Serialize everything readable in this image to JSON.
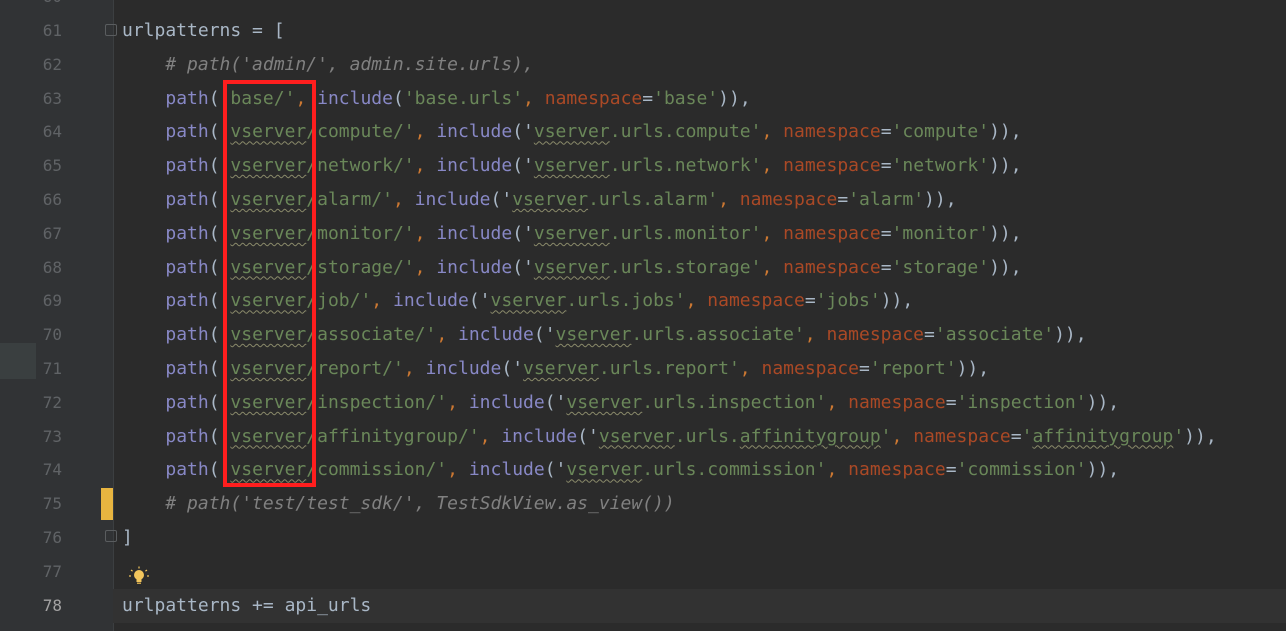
{
  "editor": {
    "lines": [
      {
        "num": "61",
        "tokens": [
          {
            "t": "urlpatterns ",
            "c": "kw"
          },
          {
            "t": "=",
            "c": "kw"
          },
          {
            "t": " [",
            "c": "kw"
          }
        ]
      },
      {
        "num": "62",
        "tokens": [
          {
            "t": "    # path('admin/', admin.site.urls),",
            "c": "cmg"
          }
        ]
      },
      {
        "num": "63",
        "tokens": [
          {
            "t": "    ",
            "c": "kw"
          },
          {
            "t": "path",
            "c": "fn"
          },
          {
            "t": "('",
            "c": "kw"
          },
          {
            "t": "base/'",
            "c": "str"
          },
          {
            "t": ", ",
            "c": "op"
          },
          {
            "t": "include",
            "c": "fn"
          },
          {
            "t": "(",
            "c": "kw"
          },
          {
            "t": "'base.urls'",
            "c": "str"
          },
          {
            "t": ", ",
            "c": "op"
          },
          {
            "t": "namespace",
            "c": "named"
          },
          {
            "t": "=",
            "c": "kw"
          },
          {
            "t": "'base'",
            "c": "str"
          },
          {
            "t": ")),",
            "c": "kw"
          }
        ]
      },
      {
        "num": "64",
        "tokens": [
          {
            "t": "    ",
            "c": "kw"
          },
          {
            "t": "path",
            "c": "fn"
          },
          {
            "t": "('",
            "c": "kw"
          },
          {
            "t": "vserver",
            "c": "str wavy"
          },
          {
            "t": "/compute/'",
            "c": "str"
          },
          {
            "t": ", ",
            "c": "op"
          },
          {
            "t": "include",
            "c": "fn"
          },
          {
            "t": "('",
            "c": "kw"
          },
          {
            "t": "vserver",
            "c": "str wavy"
          },
          {
            "t": ".urls.compute'",
            "c": "str"
          },
          {
            "t": ", ",
            "c": "op"
          },
          {
            "t": "namespace",
            "c": "named"
          },
          {
            "t": "=",
            "c": "kw"
          },
          {
            "t": "'compute'",
            "c": "str"
          },
          {
            "t": ")),",
            "c": "kw"
          }
        ]
      },
      {
        "num": "65",
        "tokens": [
          {
            "t": "    ",
            "c": "kw"
          },
          {
            "t": "path",
            "c": "fn"
          },
          {
            "t": "('",
            "c": "kw"
          },
          {
            "t": "vserver",
            "c": "str wavy"
          },
          {
            "t": "/network/'",
            "c": "str"
          },
          {
            "t": ", ",
            "c": "op"
          },
          {
            "t": "include",
            "c": "fn"
          },
          {
            "t": "('",
            "c": "kw"
          },
          {
            "t": "vserver",
            "c": "str wavy"
          },
          {
            "t": ".urls.network'",
            "c": "str"
          },
          {
            "t": ", ",
            "c": "op"
          },
          {
            "t": "namespace",
            "c": "named"
          },
          {
            "t": "=",
            "c": "kw"
          },
          {
            "t": "'network'",
            "c": "str"
          },
          {
            "t": ")),",
            "c": "kw"
          }
        ]
      },
      {
        "num": "66",
        "tokens": [
          {
            "t": "    ",
            "c": "kw"
          },
          {
            "t": "path",
            "c": "fn"
          },
          {
            "t": "('",
            "c": "kw"
          },
          {
            "t": "vserver",
            "c": "str wavy"
          },
          {
            "t": "/alarm/'",
            "c": "str"
          },
          {
            "t": ", ",
            "c": "op"
          },
          {
            "t": "include",
            "c": "fn"
          },
          {
            "t": "('",
            "c": "kw"
          },
          {
            "t": "vserver",
            "c": "str wavy"
          },
          {
            "t": ".urls.alarm'",
            "c": "str"
          },
          {
            "t": ", ",
            "c": "op"
          },
          {
            "t": "namespace",
            "c": "named"
          },
          {
            "t": "=",
            "c": "kw"
          },
          {
            "t": "'alarm'",
            "c": "str"
          },
          {
            "t": ")),",
            "c": "kw"
          }
        ]
      },
      {
        "num": "67",
        "tokens": [
          {
            "t": "    ",
            "c": "kw"
          },
          {
            "t": "path",
            "c": "fn"
          },
          {
            "t": "('",
            "c": "kw"
          },
          {
            "t": "vserver",
            "c": "str wavy"
          },
          {
            "t": "/monitor/'",
            "c": "str"
          },
          {
            "t": ", ",
            "c": "op"
          },
          {
            "t": "include",
            "c": "fn"
          },
          {
            "t": "('",
            "c": "kw"
          },
          {
            "t": "vserver",
            "c": "str wavy"
          },
          {
            "t": ".urls.monitor'",
            "c": "str"
          },
          {
            "t": ", ",
            "c": "op"
          },
          {
            "t": "namespace",
            "c": "named"
          },
          {
            "t": "=",
            "c": "kw"
          },
          {
            "t": "'monitor'",
            "c": "str"
          },
          {
            "t": ")),",
            "c": "kw"
          }
        ]
      },
      {
        "num": "68",
        "tokens": [
          {
            "t": "    ",
            "c": "kw"
          },
          {
            "t": "path",
            "c": "fn"
          },
          {
            "t": "('",
            "c": "kw"
          },
          {
            "t": "vserver",
            "c": "str wavy"
          },
          {
            "t": "/storage/'",
            "c": "str"
          },
          {
            "t": ", ",
            "c": "op"
          },
          {
            "t": "include",
            "c": "fn"
          },
          {
            "t": "('",
            "c": "kw"
          },
          {
            "t": "vserver",
            "c": "str wavy"
          },
          {
            "t": ".urls.storage'",
            "c": "str"
          },
          {
            "t": ", ",
            "c": "op"
          },
          {
            "t": "namespace",
            "c": "named"
          },
          {
            "t": "=",
            "c": "kw"
          },
          {
            "t": "'storage'",
            "c": "str"
          },
          {
            "t": ")),",
            "c": "kw"
          }
        ]
      },
      {
        "num": "69",
        "tokens": [
          {
            "t": "    ",
            "c": "kw"
          },
          {
            "t": "path",
            "c": "fn"
          },
          {
            "t": "('",
            "c": "kw"
          },
          {
            "t": "vserver",
            "c": "str wavy"
          },
          {
            "t": "/job/'",
            "c": "str"
          },
          {
            "t": ", ",
            "c": "op"
          },
          {
            "t": "include",
            "c": "fn"
          },
          {
            "t": "('",
            "c": "kw"
          },
          {
            "t": "vserver",
            "c": "str wavy"
          },
          {
            "t": ".urls.jobs'",
            "c": "str"
          },
          {
            "t": ", ",
            "c": "op"
          },
          {
            "t": "namespace",
            "c": "named"
          },
          {
            "t": "=",
            "c": "kw"
          },
          {
            "t": "'jobs'",
            "c": "str"
          },
          {
            "t": ")),",
            "c": "kw"
          }
        ]
      },
      {
        "num": "70",
        "tokens": [
          {
            "t": "    ",
            "c": "kw"
          },
          {
            "t": "path",
            "c": "fn"
          },
          {
            "t": "('",
            "c": "kw"
          },
          {
            "t": "vserver",
            "c": "str wavy"
          },
          {
            "t": "/associate/'",
            "c": "str"
          },
          {
            "t": ", ",
            "c": "op"
          },
          {
            "t": "include",
            "c": "fn"
          },
          {
            "t": "('",
            "c": "kw"
          },
          {
            "t": "vserver",
            "c": "str wavy"
          },
          {
            "t": ".urls.associate'",
            "c": "str"
          },
          {
            "t": ", ",
            "c": "op"
          },
          {
            "t": "namespace",
            "c": "named"
          },
          {
            "t": "=",
            "c": "kw"
          },
          {
            "t": "'associate'",
            "c": "str"
          },
          {
            "t": ")),",
            "c": "kw"
          }
        ]
      },
      {
        "num": "71",
        "tokens": [
          {
            "t": "    ",
            "c": "kw"
          },
          {
            "t": "path",
            "c": "fn"
          },
          {
            "t": "('",
            "c": "kw"
          },
          {
            "t": "vserver",
            "c": "str wavy"
          },
          {
            "t": "/report/'",
            "c": "str"
          },
          {
            "t": ", ",
            "c": "op"
          },
          {
            "t": "include",
            "c": "fn"
          },
          {
            "t": "('",
            "c": "kw"
          },
          {
            "t": "vserver",
            "c": "str wavy"
          },
          {
            "t": ".urls.report'",
            "c": "str"
          },
          {
            "t": ", ",
            "c": "op"
          },
          {
            "t": "namespace",
            "c": "named"
          },
          {
            "t": "=",
            "c": "kw"
          },
          {
            "t": "'report'",
            "c": "str"
          },
          {
            "t": ")),",
            "c": "kw"
          }
        ]
      },
      {
        "num": "72",
        "tokens": [
          {
            "t": "    ",
            "c": "kw"
          },
          {
            "t": "path",
            "c": "fn"
          },
          {
            "t": "('",
            "c": "kw"
          },
          {
            "t": "vserver",
            "c": "str wavy"
          },
          {
            "t": "/inspection/'",
            "c": "str"
          },
          {
            "t": ", ",
            "c": "op"
          },
          {
            "t": "include",
            "c": "fn"
          },
          {
            "t": "('",
            "c": "kw"
          },
          {
            "t": "vserver",
            "c": "str wavy"
          },
          {
            "t": ".urls.inspection'",
            "c": "str"
          },
          {
            "t": ", ",
            "c": "op"
          },
          {
            "t": "namespace",
            "c": "named"
          },
          {
            "t": "=",
            "c": "kw"
          },
          {
            "t": "'inspection'",
            "c": "str"
          },
          {
            "t": ")),",
            "c": "kw"
          }
        ]
      },
      {
        "num": "73",
        "tokens": [
          {
            "t": "    ",
            "c": "kw"
          },
          {
            "t": "path",
            "c": "fn"
          },
          {
            "t": "('",
            "c": "kw"
          },
          {
            "t": "vserver",
            "c": "str wavy"
          },
          {
            "t": "/affinitygroup/'",
            "c": "str"
          },
          {
            "t": ", ",
            "c": "op"
          },
          {
            "t": "include",
            "c": "fn"
          },
          {
            "t": "('",
            "c": "kw"
          },
          {
            "t": "vserver",
            "c": "str wavy"
          },
          {
            "t": ".urls.",
            "c": "str"
          },
          {
            "t": "affinitygroup",
            "c": "str wavy"
          },
          {
            "t": "'",
            "c": "str"
          },
          {
            "t": ", ",
            "c": "op"
          },
          {
            "t": "namespace",
            "c": "named"
          },
          {
            "t": "=",
            "c": "kw"
          },
          {
            "t": "'",
            "c": "str"
          },
          {
            "t": "affinitygroup",
            "c": "str wavy"
          },
          {
            "t": "'",
            "c": "str"
          },
          {
            "t": ")),",
            "c": "kw"
          }
        ]
      },
      {
        "num": "74",
        "tokens": [
          {
            "t": "    ",
            "c": "kw"
          },
          {
            "t": "path",
            "c": "fn"
          },
          {
            "t": "('",
            "c": "kw"
          },
          {
            "t": "vserver",
            "c": "str wavy"
          },
          {
            "t": "/commission/'",
            "c": "str"
          },
          {
            "t": ", ",
            "c": "op"
          },
          {
            "t": "include",
            "c": "fn"
          },
          {
            "t": "('",
            "c": "kw"
          },
          {
            "t": "vserver",
            "c": "str wavy"
          },
          {
            "t": ".urls.commission'",
            "c": "str"
          },
          {
            "t": ", ",
            "c": "op"
          },
          {
            "t": "namespace",
            "c": "named"
          },
          {
            "t": "=",
            "c": "kw"
          },
          {
            "t": "'commission'",
            "c": "str"
          },
          {
            "t": ")),",
            "c": "kw"
          }
        ]
      },
      {
        "num": "75",
        "tokens": [
          {
            "t": "    # path('test/test_sdk/', TestSdkView.as_view())",
            "c": "cmg"
          }
        ]
      },
      {
        "num": "76",
        "tokens": [
          {
            "t": "]",
            "c": "kw"
          }
        ]
      },
      {
        "num": "77",
        "tokens": []
      },
      {
        "num": "78",
        "tokens": [
          {
            "t": "urlpatterns ",
            "c": "kw"
          },
          {
            "t": "+=",
            "c": "kw"
          },
          {
            "t": " api_urls",
            "c": "kw"
          }
        ]
      }
    ],
    "current_line": "78",
    "top_partial_line": "60"
  }
}
